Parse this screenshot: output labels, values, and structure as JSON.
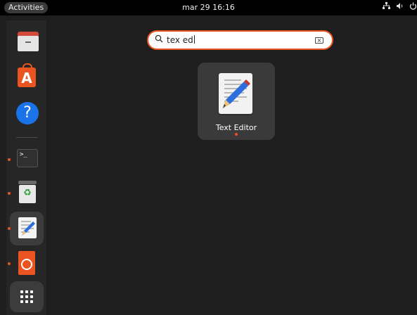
{
  "topbar": {
    "activities_label": "Activities",
    "clock": "mar 29  16:16",
    "icons": [
      "network-icon",
      "volume-icon",
      "power-icon"
    ]
  },
  "dock": {
    "items": [
      {
        "name": "files",
        "icon": "files-icon",
        "running": false
      },
      {
        "name": "app-center",
        "icon": "software-store-icon",
        "glyph": "A",
        "running": false
      },
      {
        "name": "help",
        "icon": "help-icon",
        "glyph": "?",
        "running": false
      },
      {
        "name": "terminal",
        "icon": "terminal-icon",
        "glyph": ">_",
        "running": true
      },
      {
        "name": "trash",
        "icon": "trash-icon",
        "glyph": "♻",
        "running": true
      },
      {
        "name": "text-editor",
        "icon": "text-editor-icon",
        "running": true,
        "active": true
      },
      {
        "name": "ubuntu",
        "icon": "ubuntu-icon",
        "running": true
      }
    ],
    "show_apps_icon": "app-grid-icon"
  },
  "search": {
    "icon": "search-icon",
    "value": "tex ed",
    "clear_icon": "clear-icon"
  },
  "results": [
    {
      "label": "Text Editor",
      "icon": "text-editor-icon",
      "running": true
    }
  ],
  "colors": {
    "accent": "#e95420",
    "background": "#1e1e1e",
    "dock": "#262626",
    "topbar": "#000000",
    "result_bg": "#3a3a3a"
  }
}
